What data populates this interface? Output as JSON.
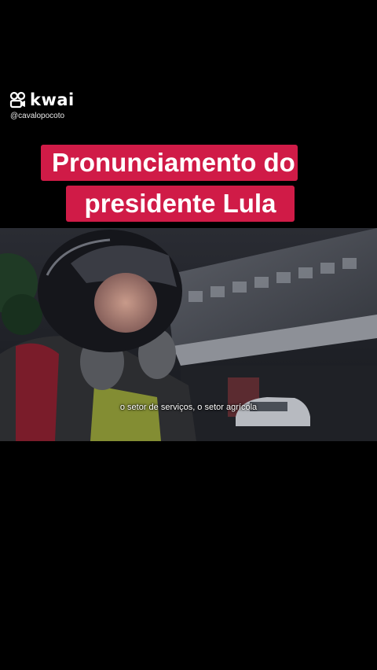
{
  "watermark": {
    "brand": "kwai",
    "handle": "@cavalopocoto"
  },
  "title": {
    "line1": "Pronunciamento do",
    "line2": "presidente Lula"
  },
  "video": {
    "subtitle": "o setor de serviços, o setor agrícola"
  },
  "colors": {
    "title_bg": "#d01b47",
    "background": "#000000",
    "libras_frame": "#c9f01a"
  }
}
